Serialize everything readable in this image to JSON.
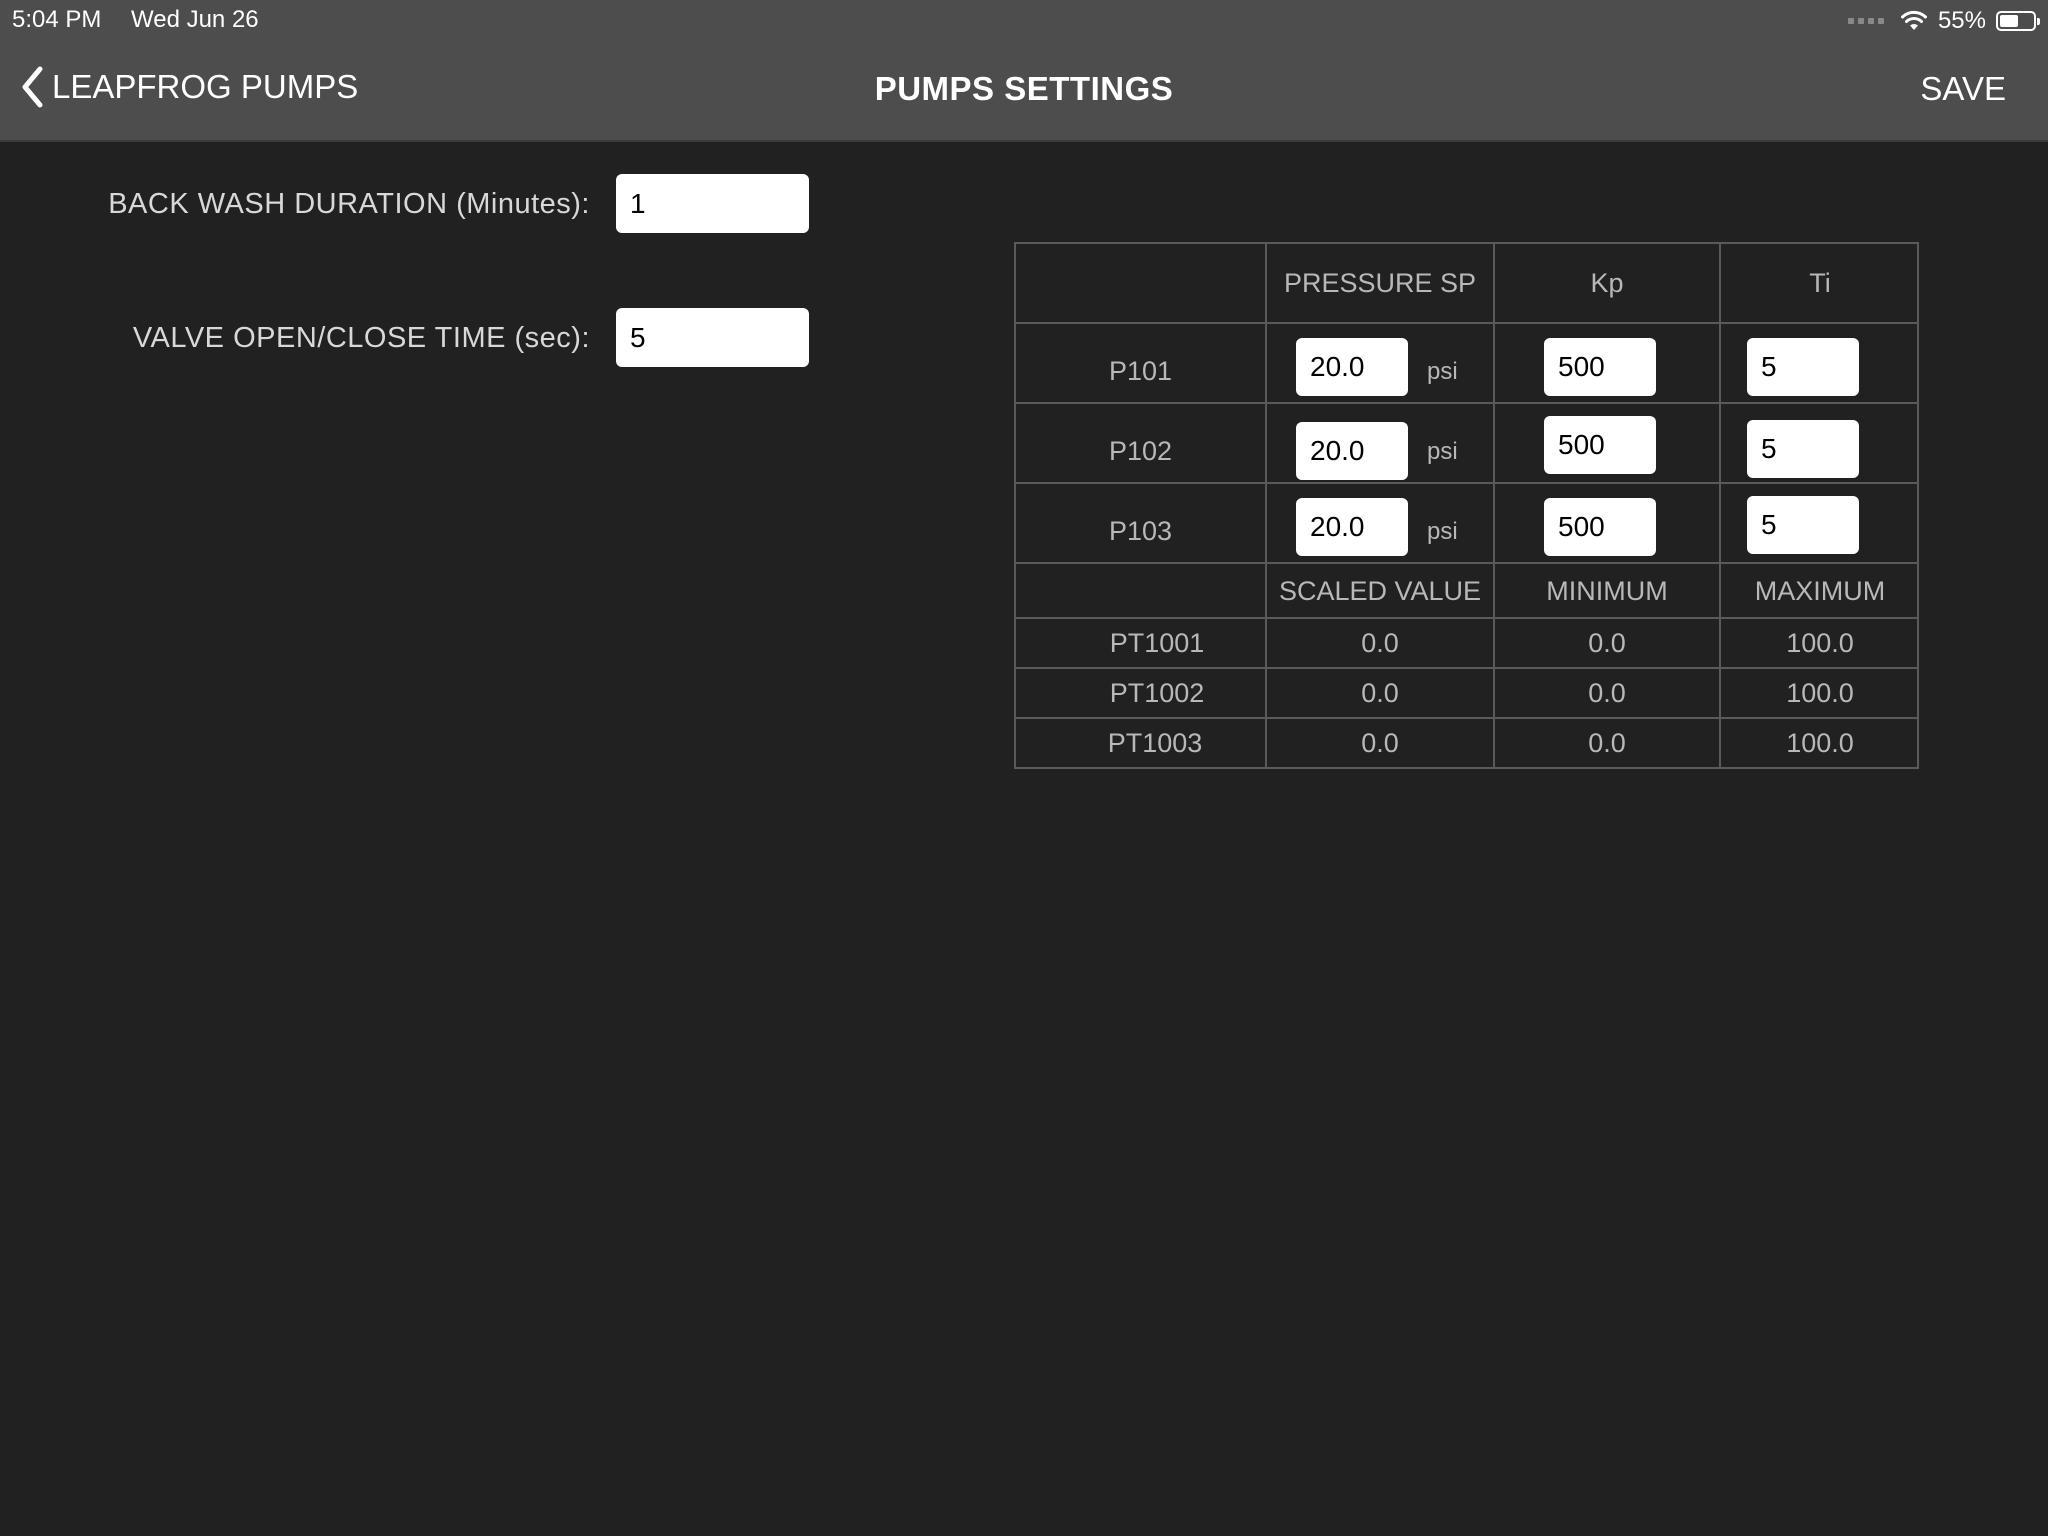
{
  "status_bar": {
    "time": "5:04 PM",
    "date": "Wed Jun 26",
    "battery": "55%",
    "battery_level": 0.55
  },
  "nav": {
    "back_label": "LEAPFROG PUMPS",
    "title": "PUMPS SETTINGS",
    "save_label": "SAVE"
  },
  "form": {
    "backwash_label": "BACK WASH DURATION (Minutes):",
    "backwash_value": "1",
    "valve_label": "VALVE OPEN/CLOSE TIME (sec):",
    "valve_value": "5"
  },
  "pump_table": {
    "headers": [
      "PRESSURE SP",
      "Kp",
      "Ti"
    ],
    "unit": "psi",
    "rows": [
      {
        "name": "P101",
        "pressure_sp": "20.0",
        "kp": "500",
        "ti": "5"
      },
      {
        "name": "P102",
        "pressure_sp": "20.0",
        "kp": "500",
        "ti": "5"
      },
      {
        "name": "P103",
        "pressure_sp": "20.0",
        "kp": "500",
        "ti": "5"
      }
    ]
  },
  "sensor_table": {
    "headers": [
      "SCALED VALUE",
      "MINIMUM",
      "MAXIMUM"
    ],
    "rows": [
      {
        "name": "PT1001",
        "scaled": "0.0",
        "min": "0.0",
        "max": "100.0"
      },
      {
        "name": "PT1002",
        "scaled": "0.0",
        "min": "0.0",
        "max": "100.0"
      },
      {
        "name": "PT1003",
        "scaled": "0.0",
        "min": "0.0",
        "max": "100.0"
      }
    ]
  }
}
